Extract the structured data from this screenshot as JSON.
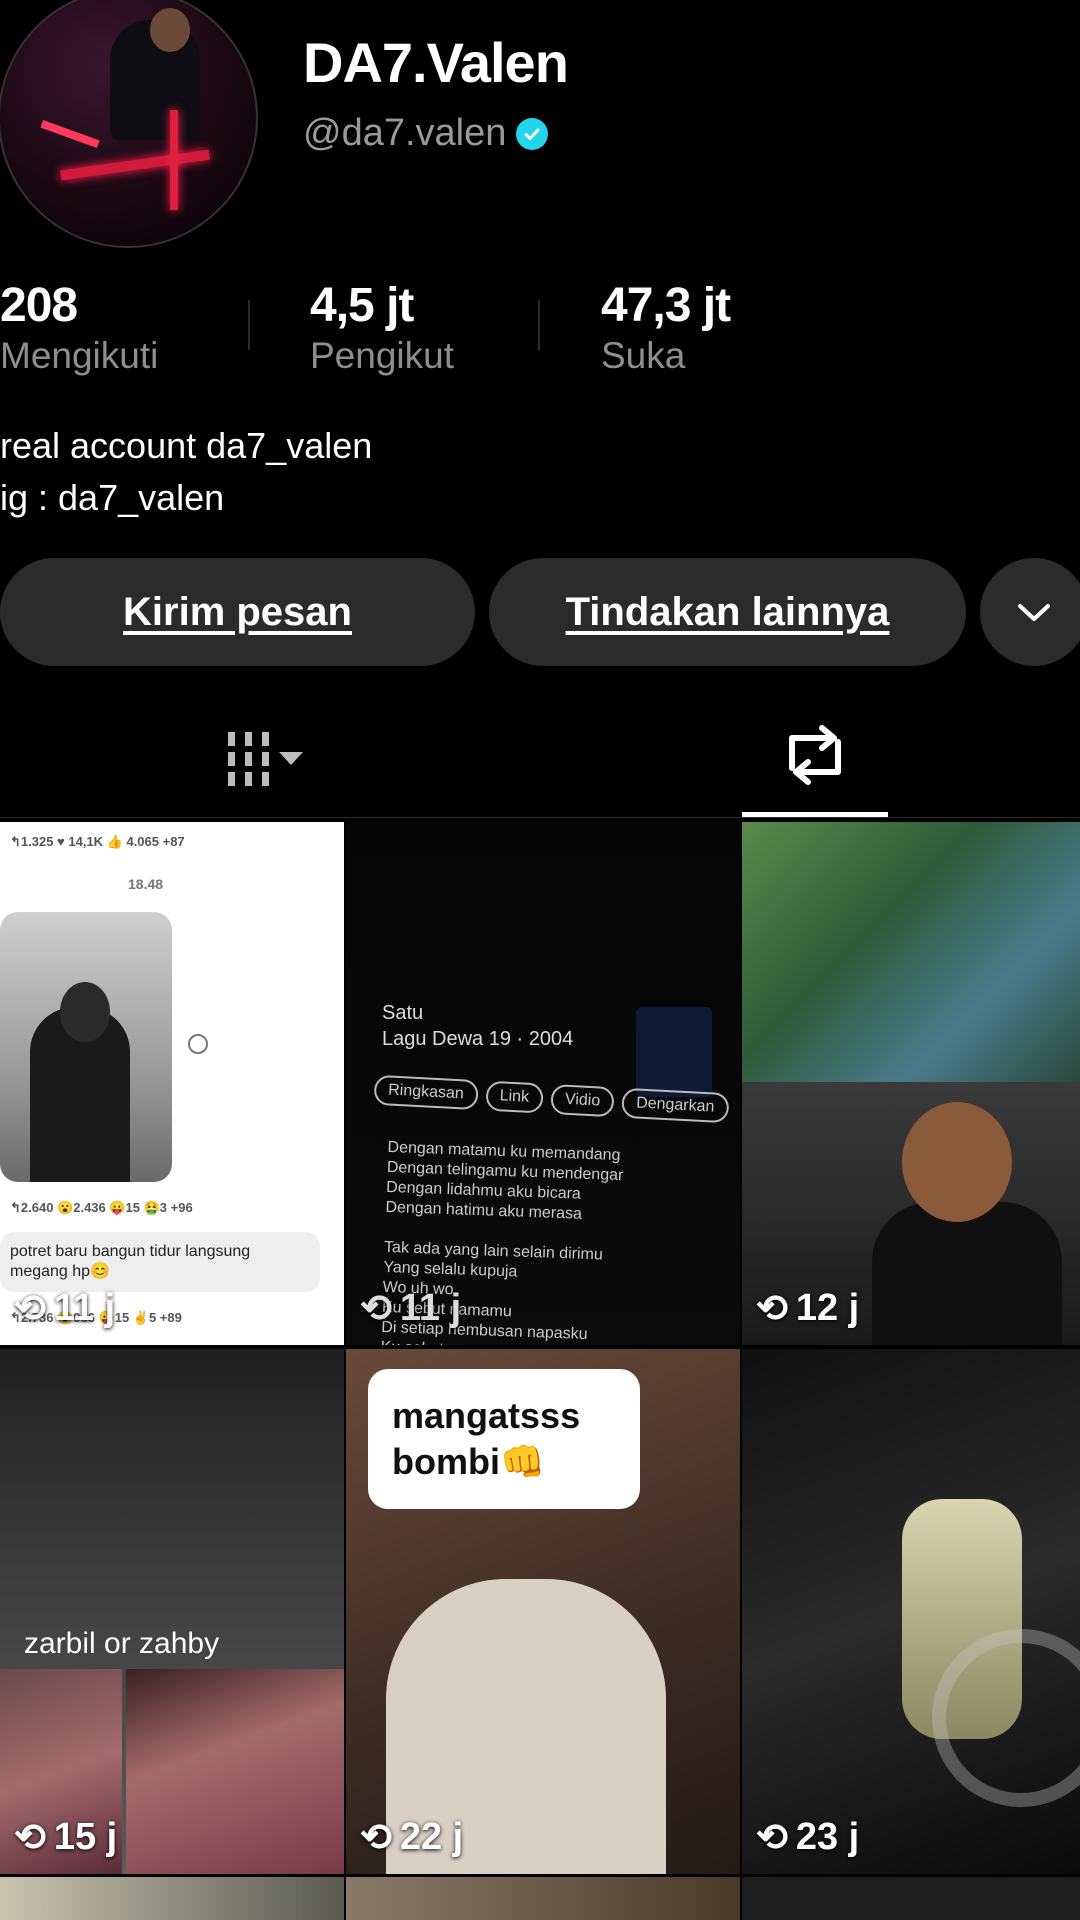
{
  "profile": {
    "display_name": "DA7.Valen",
    "username": "@da7.valen",
    "verified_icon": "verified-badge-icon",
    "stats": [
      {
        "value": "208",
        "label": "Mengikuti"
      },
      {
        "value": "4,5 jt",
        "label": "Pengikut"
      },
      {
        "value": "47,3 jt",
        "label": "Suka"
      }
    ],
    "bio_lines": [
      "real account da7_valen",
      "ig : da7_valen"
    ]
  },
  "actions": {
    "message_label": "Kirim pesan",
    "more_actions_label": "Tindakan lainnya",
    "dropdown_icon": "chevron-down-icon"
  },
  "tabs": {
    "videos_icon": "grid-icon",
    "reposts_icon": "repost-icon",
    "active": "reposts"
  },
  "posts": [
    {
      "count": "11 j",
      "chat": {
        "top_reactions": "↰1.325   ♥ 14,1K   👍 4.065   +87",
        "time": "18.48",
        "mid_reactions": "↰2.640   😮2.436   😛15   🤮3   +96",
        "message": "potret baru bangun tidur langsung megang hp😊",
        "bottom_reactions": "↰2.736   😮966   😛15   ✌5   +89"
      }
    },
    {
      "count": "11 j",
      "song": {
        "title": "Satu",
        "subtitle": "Lagu Dewa 19 · 2004",
        "chips": [
          "Ringkasan",
          "Link",
          "Vidio",
          "Dengarkan"
        ],
        "lyrics": "Dengan matamu ku memandang\nDengan telingamu ku mendengar\nDengan lidahmu aku bicara\nDengan hatimu aku merasa\n\nTak ada yang lain selain dirimu\nYang selalu kupuja\nWo uh wo\nKu sebut namamu\nDi setiap hembusan napasku\nKu sebut namamu"
      }
    },
    {
      "count": "12 j"
    },
    {
      "count": "15 j",
      "caption": "zarbil or zahby"
    },
    {
      "count": "22 j",
      "caption": "mangatsss bombi👊"
    },
    {
      "count": "23 j"
    }
  ]
}
